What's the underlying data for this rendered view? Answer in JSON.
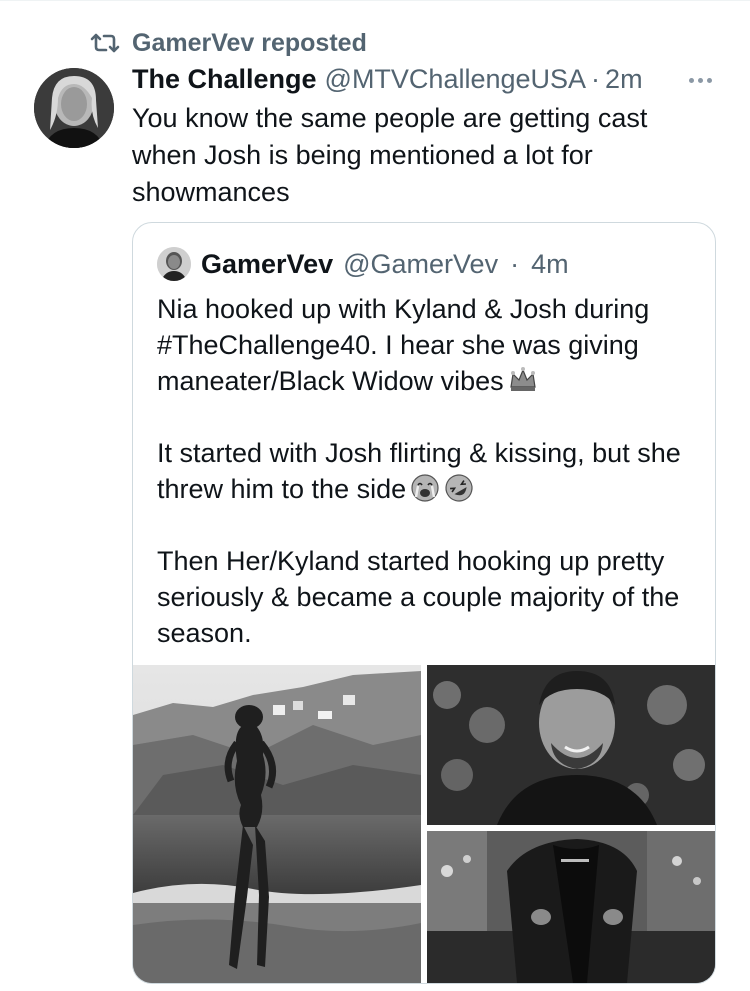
{
  "repost": {
    "label": "GamerVev reposted",
    "icon": "repost-icon"
  },
  "tweet": {
    "author_name": "The Challenge",
    "author_handle": "@MTVChallengeUSA",
    "separator": "·",
    "time": "2m",
    "text": "You know the same people are getting cast when Josh is being mentioned a lot for showmances",
    "more_icon": "more-icon"
  },
  "quote": {
    "author_name": "GamerVev",
    "author_handle": "@GamerVev",
    "separator": "·",
    "time": "4m",
    "paragraph_1": "Nia hooked up with Kyland & Josh during #TheChallenge40. I hear she was giving maneater/Black Widow vibes",
    "paragraph_2": "It started with Josh flirting & kissing, but she threw him to the side",
    "paragraph_3": "Then Her/Kyland started hooking up pretty seriously & became a couple majority of the season.",
    "emojis": [
      "crown-icon",
      "crying-face-icon",
      "rolling-laughing-icon"
    ]
  }
}
